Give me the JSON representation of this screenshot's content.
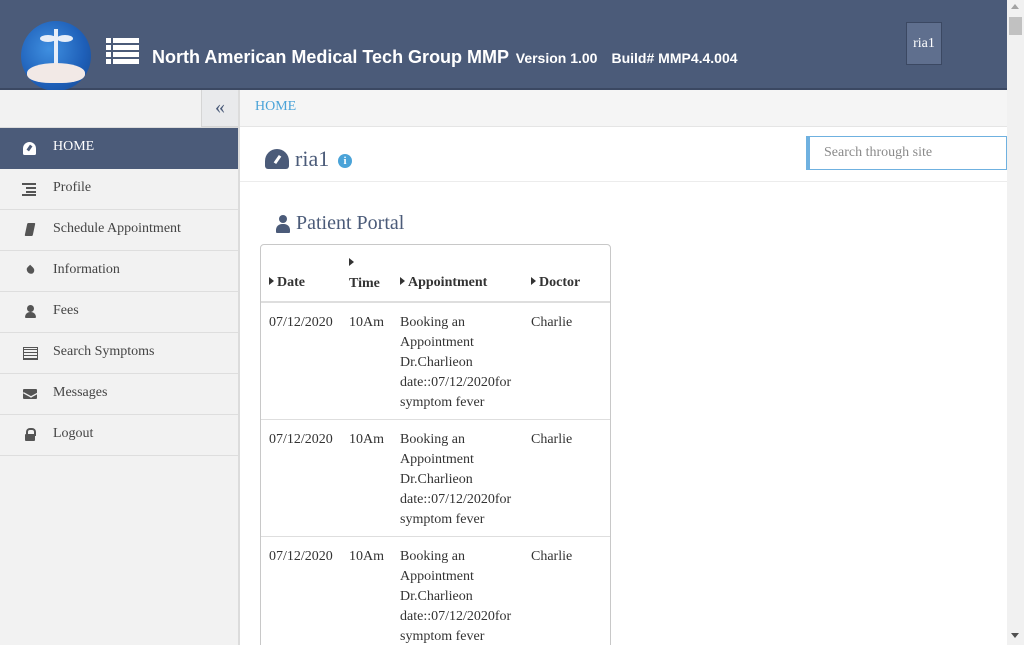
{
  "header": {
    "title": "North American Medical Tech Group MMP",
    "version": "Version 1.00",
    "build": "Build# MMP4.4.004",
    "user": "ria1"
  },
  "sidebar": {
    "collapse_icon": "«",
    "items": [
      {
        "label": "HOME",
        "icon": "dashboard-icon",
        "active": true
      },
      {
        "label": "Profile",
        "icon": "list-icon"
      },
      {
        "label": "Schedule Appointment",
        "icon": "book-icon"
      },
      {
        "label": "Information",
        "icon": "drop-icon"
      },
      {
        "label": "Fees",
        "icon": "user-icon"
      },
      {
        "label": "Search Symptoms",
        "icon": "table-icon"
      },
      {
        "label": "Messages",
        "icon": "envelope-icon"
      },
      {
        "label": "Logout",
        "icon": "lock-icon"
      }
    ]
  },
  "breadcrumb": "HOME",
  "page": {
    "title": "ria1",
    "info_icon": "i",
    "search_placeholder": "Search through site"
  },
  "portal": {
    "title": "Patient Portal",
    "columns": [
      "Date",
      "Time",
      "Appointment",
      "Doctor"
    ],
    "rows": [
      {
        "date": "07/12/2020",
        "time": "10Am",
        "appointment": [
          "Booking an",
          "Appointment",
          "Dr.Charlieon",
          "date::07/12/2020for",
          "symptom fever"
        ],
        "doctor": "Charlie"
      },
      {
        "date": "07/12/2020",
        "time": "10Am",
        "appointment": [
          "Booking an",
          "Appointment",
          "Dr.Charlieon",
          "date::07/12/2020for",
          "symptom fever"
        ],
        "doctor": "Charlie"
      },
      {
        "date": "07/12/2020",
        "time": "10Am",
        "appointment": [
          "Booking an",
          "Appointment",
          "Dr.Charlieon",
          "date::07/12/2020for",
          "symptom fever"
        ],
        "doctor": "Charlie"
      }
    ]
  },
  "colors": {
    "header_bg": "#4b5b79",
    "active_nav": "#4b5b79",
    "link": "#4aa3d8"
  }
}
